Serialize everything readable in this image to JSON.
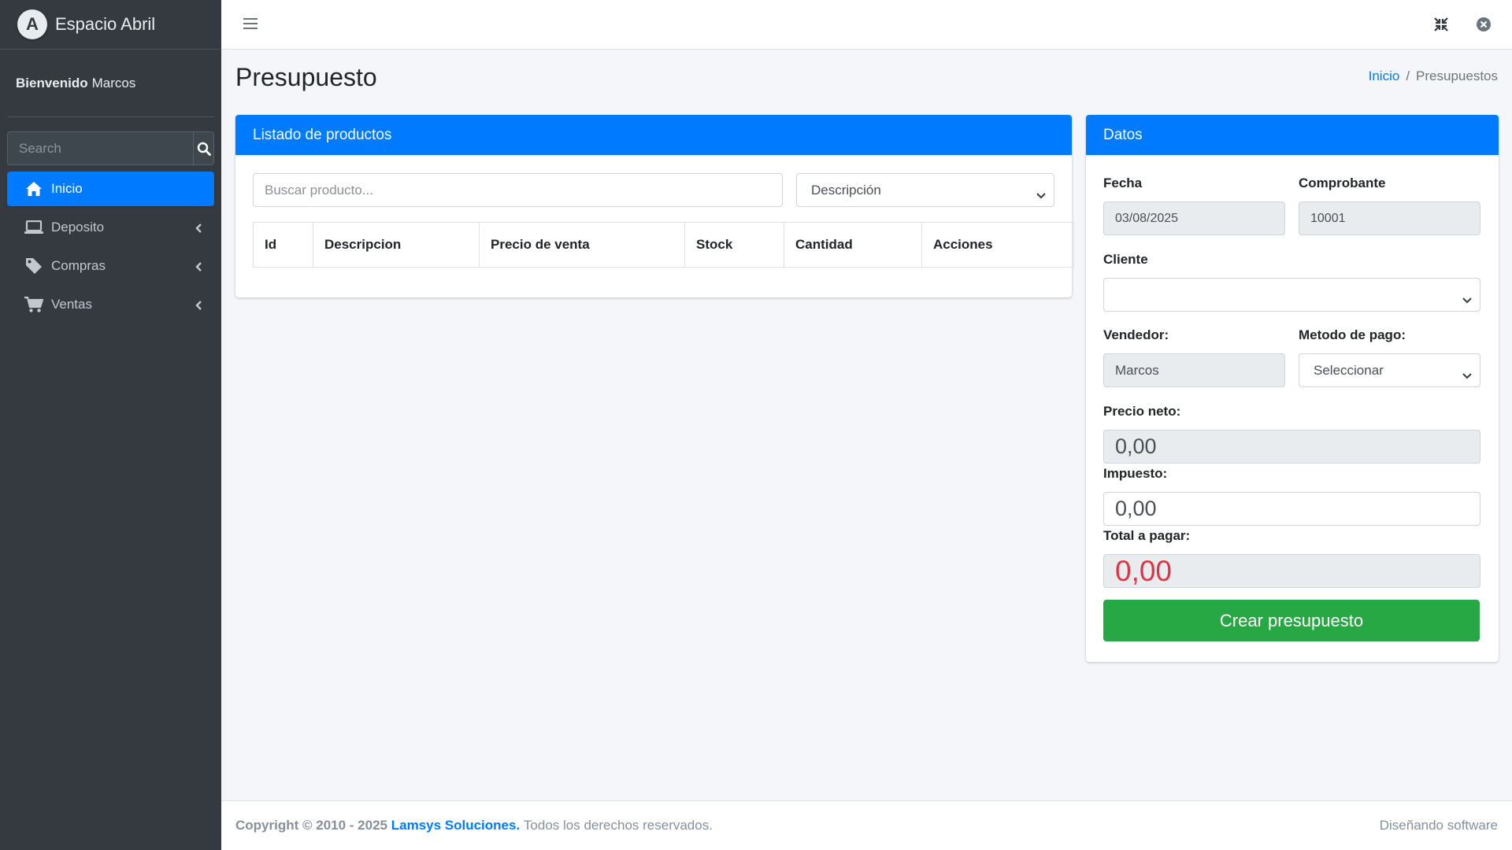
{
  "brand": {
    "logo_letter": "A",
    "name": "Espacio Abril"
  },
  "user": {
    "greeting": "Bienvenido",
    "name": "Marcos"
  },
  "sidebar": {
    "search_placeholder": "Search",
    "items": [
      {
        "label": "Inicio",
        "icon": "home-icon",
        "active": true
      },
      {
        "label": "Deposito",
        "icon": "laptop-icon"
      },
      {
        "label": "Compras",
        "icon": "tag-icon"
      },
      {
        "label": "Ventas",
        "icon": "cart-icon"
      }
    ]
  },
  "header": {
    "icons": [
      "hamburger-icon",
      "fullscreen-exit-icon",
      "close-circle-icon"
    ]
  },
  "page": {
    "title": "Presupuesto",
    "breadcrumb": {
      "home": "Inicio",
      "current": "Presupuestos"
    }
  },
  "products_card": {
    "title": "Listado de productos",
    "search_placeholder": "Buscar producto...",
    "filter_selected": "Descripción",
    "columns": [
      "Id",
      "Descripcion",
      "Precio de venta",
      "Stock",
      "Cantidad",
      "Acciones"
    ]
  },
  "datos_card": {
    "title": "Datos",
    "fecha_label": "Fecha",
    "fecha_value": "03/08/2025",
    "comprobante_label": "Comprobante",
    "comprobante_value": "10001",
    "cliente_label": "Cliente",
    "cliente_value": "",
    "vendedor_label": "Vendedor:",
    "vendedor_value": "Marcos",
    "metodo_label": "Metodo de pago:",
    "metodo_value": "Seleccionar",
    "precio_neto_label": "Precio neto:",
    "precio_neto_value": "0,00",
    "impuesto_label": "Impuesto:",
    "impuesto_value": "0,00",
    "total_label": "Total a pagar:",
    "total_value": "0,00",
    "submit_label": "Crear presupuesto"
  },
  "footer": {
    "copyright": "Copyright © 2010 - 2025",
    "company": "Lamsys Soluciones.",
    "rights": "Todos los derechos reservados.",
    "right_text": "Diseñando software"
  },
  "colors": {
    "primary": "#007bff",
    "success": "#28a745",
    "danger": "#dc3545",
    "sidebar": "#343a40"
  }
}
